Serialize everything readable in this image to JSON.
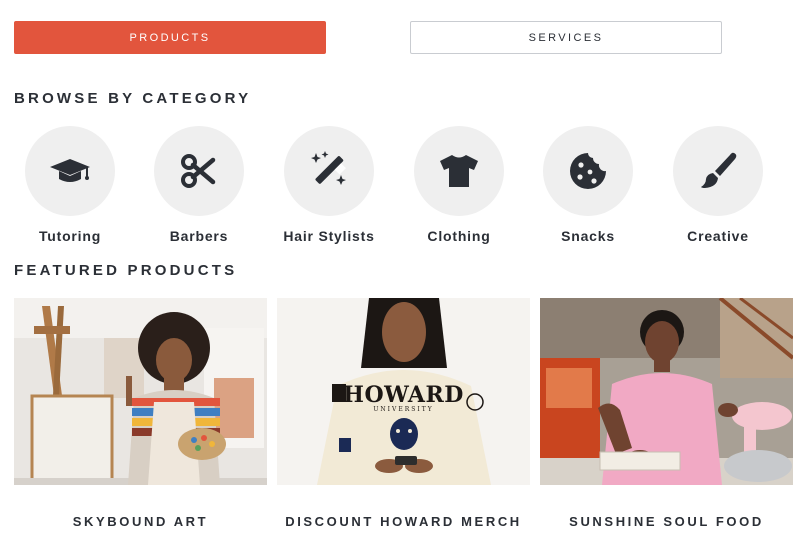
{
  "tabs": {
    "products_label": "PRODUCTS",
    "services_label": "SERVICES",
    "active_color": "#e2553d"
  },
  "browse": {
    "title": "BROWSE BY CATEGORY",
    "categories": [
      {
        "label": "Tutoring",
        "icon": "graduation-cap-icon"
      },
      {
        "label": "Barbers",
        "icon": "scissors-icon"
      },
      {
        "label": "Hair Stylists",
        "icon": "magic-wand-icon"
      },
      {
        "label": "Clothing",
        "icon": "tshirt-icon"
      },
      {
        "label": "Snacks",
        "icon": "cookie-icon"
      },
      {
        "label": "Creative",
        "icon": "paintbrush-icon"
      }
    ]
  },
  "featured": {
    "title": "FEATURED PRODUCTS",
    "products": [
      {
        "name": "SKYBOUND ART",
        "image": "artist-with-palette-photo"
      },
      {
        "name": "DISCOUNT HOWARD MERCH",
        "image": "howard-sweatshirt-photo",
        "shirt_text": "HOWARD",
        "shirt_subtext": "UNIVERSITY"
      },
      {
        "name": "SUNSHINE SOUL FOOD",
        "image": "chef-in-kitchen-photo"
      }
    ]
  }
}
